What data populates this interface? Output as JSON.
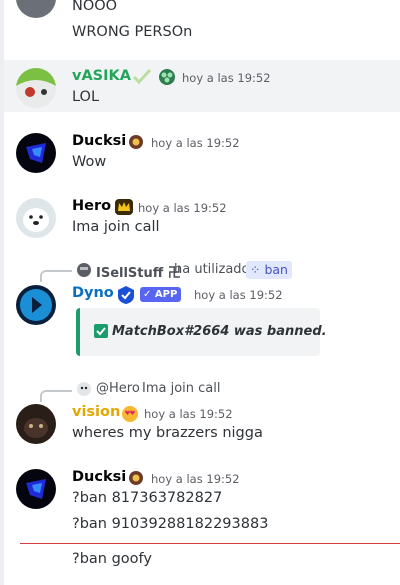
{
  "messages": [
    {
      "id": "m0",
      "lines": [
        "NOOO",
        "WRONG PERSOn"
      ]
    },
    {
      "id": "m1",
      "author": "vASIKA",
      "author_color": "#23a55a",
      "timestamp": "hoy a las 19:52",
      "lines": [
        "LOL"
      ],
      "highlighted": true
    },
    {
      "id": "m2",
      "author": "Ducksi",
      "author_color": "#060607",
      "timestamp": "hoy a las 19:52",
      "lines": [
        "Wow"
      ]
    },
    {
      "id": "m3",
      "author": "Hero",
      "author_color": "#060607",
      "timestamp": "hoy a las 19:52",
      "lines": [
        "Ima join call"
      ]
    },
    {
      "id": "m4",
      "reply_user": "ISellStuff 卍",
      "reply_used": "ha utilizado",
      "reply_command": "ban",
      "author": "Dyno",
      "author_color": "#0b6fbf",
      "app_badge": "APP",
      "timestamp": "hoy a las 19:52",
      "embed_text": "MatchBox#2664 was banned."
    },
    {
      "id": "m5",
      "reply_user": "@Hero",
      "reply_text": "Ima join call",
      "author": "vision",
      "author_color": "#e0a800",
      "timestamp": "hoy a las 19:52",
      "lines": [
        "wheres my brazzers nigga"
      ]
    },
    {
      "id": "m6",
      "author": "Ducksi",
      "author_color": "#060607",
      "timestamp": "hoy a las 19:52",
      "lines": [
        "?ban 817363782827",
        "?ban 91039288182293883"
      ]
    },
    {
      "id": "m7",
      "lines": [
        "?ban goofy"
      ]
    }
  ],
  "colors": {
    "highlight_bg": "#f2f3f5",
    "new_divider": "#d83c3e",
    "embed_border": "#1a9c6b",
    "app_badge_bg": "#5865f2"
  }
}
